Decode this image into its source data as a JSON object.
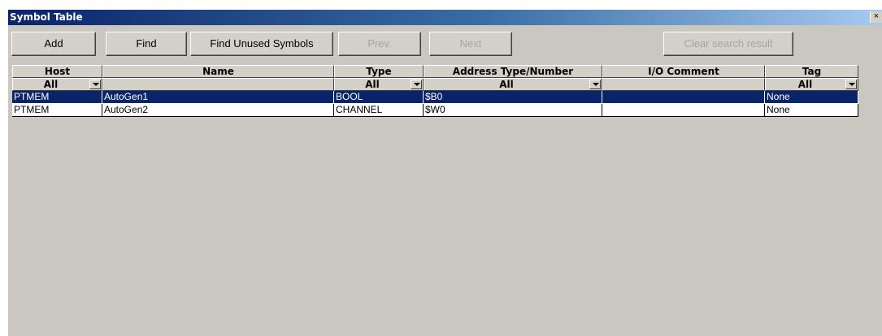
{
  "window": {
    "title": "Symbol Table",
    "close_glyph": "×"
  },
  "toolbar": {
    "add": "Add",
    "find": "Find",
    "find_unused": "Find Unused Symbols",
    "prev": "Prev.",
    "next": "Next",
    "clear": "Clear search result"
  },
  "columns": {
    "host": "Host",
    "name": "Name",
    "type": "Type",
    "address": "Address Type/Number",
    "comment": "I/O Comment",
    "tag": "Tag"
  },
  "filters": {
    "host": "All",
    "type": "All",
    "address": "All",
    "tag": "All"
  },
  "rows": [
    {
      "host": "PTMEM",
      "name": "AutoGen1",
      "type": "BOOL",
      "address": "$B0",
      "comment": "",
      "tag": "None",
      "selected": true
    },
    {
      "host": "PTMEM",
      "name": "AutoGen2",
      "type": "CHANNEL",
      "address": "$W0",
      "comment": "",
      "tag": "None",
      "selected": false
    }
  ],
  "colors": {
    "selection": "#0a246a",
    "window_bg": "#cac7c0",
    "title_start": "#0a246a",
    "title_end": "#a6caf0"
  }
}
